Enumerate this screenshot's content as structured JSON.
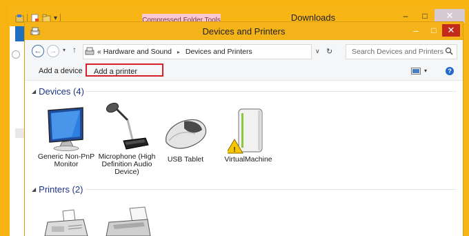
{
  "background_window": {
    "title": "Downloads",
    "tool_tab": "Compressed Folder Tools",
    "controls": {
      "minimize": "–",
      "maximize": "□",
      "close": "✕"
    }
  },
  "window": {
    "title": "Devices and Printers",
    "controls": {
      "minimize": "–",
      "maximize": "□",
      "close": "✕"
    }
  },
  "address_bar": {
    "back": "←",
    "forward": "→",
    "history": "▾",
    "up": "↑",
    "overflow": "«",
    "crumbs": [
      "Hardware and Sound",
      "Devices and Printers"
    ],
    "crumb_separator": "▸",
    "dropdown": "∨",
    "refresh": "↻",
    "search_placeholder": "Search Devices and Printers"
  },
  "command_bar": {
    "add_device_label": "Add a device",
    "add_printer_label": "Add a printer",
    "view_dropdown": "▾",
    "help": "?"
  },
  "groups": {
    "devices": {
      "toggle": "◢",
      "label": "Devices (4)",
      "items": [
        {
          "label": "Generic Non-PnP Monitor",
          "icon": "monitor-icon"
        },
        {
          "label": "Microphone (High Definition Audio Device)",
          "icon": "microphone-icon"
        },
        {
          "label": "USB Tablet",
          "icon": "mouse-icon"
        },
        {
          "label": "VirtualMachine",
          "icon": "computer-tower-icon",
          "badge": "warning-icon"
        }
      ]
    },
    "printers": {
      "toggle": "◢",
      "label": "Printers (2)",
      "items": [
        {
          "label": "",
          "icon": "fax-icon"
        },
        {
          "label": "",
          "icon": "printer-icon"
        }
      ]
    }
  },
  "colors": {
    "accent_titlebar": "#f5b31a",
    "close_button": "#c42b1c",
    "highlight_box": "#d8202a",
    "group_header_text": "#1e3287"
  }
}
